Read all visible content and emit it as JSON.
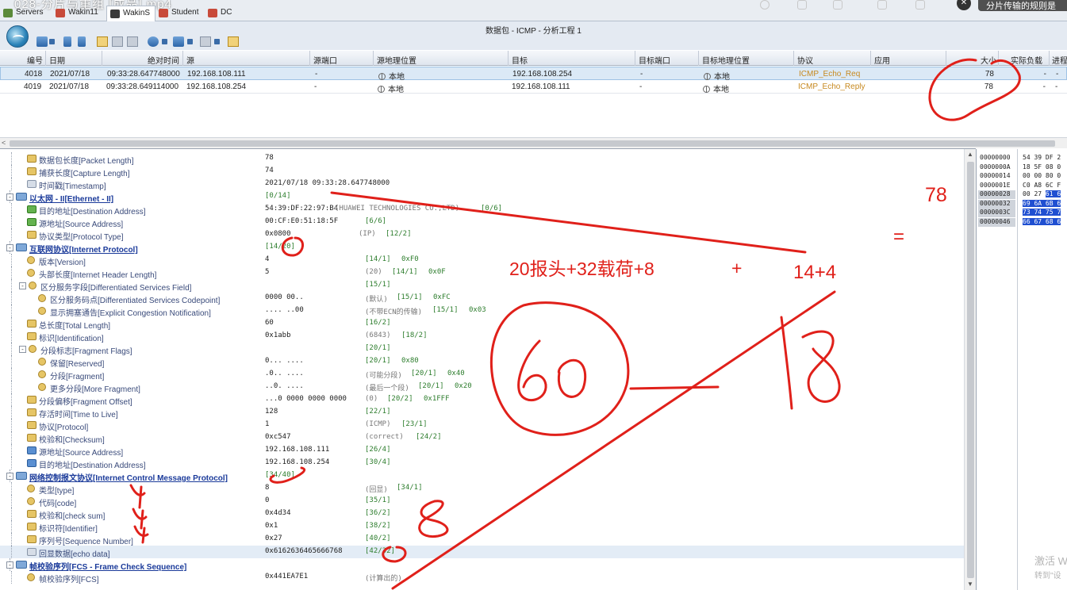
{
  "window": {
    "video_title": "028-分片与重组 [成品].mp4",
    "title": "数据包 - ICMP - 分析工程 1",
    "tooltip": "分片传输的规则是"
  },
  "tabs": [
    {
      "label": "Servers"
    },
    {
      "label": "Wakin11"
    },
    {
      "label": "WakinS"
    },
    {
      "label": "Student"
    },
    {
      "label": "DC"
    }
  ],
  "packet_list": {
    "columns": [
      "编号",
      "日期",
      "绝对时间",
      "源",
      "源端口",
      "源地理位置",
      "目标",
      "目标端口",
      "目标地理位置",
      "协议",
      "应用",
      "大小",
      "实际负载",
      "进程"
    ],
    "rows": [
      {
        "no": "4018",
        "date": "2021/07/18",
        "time": "09:33:28.647748000",
        "src": "192.168.108.111",
        "sport": "-",
        "sgeo": "本地",
        "dst": "192.168.108.254",
        "dport": "-",
        "dgeo": "本地",
        "proto": "ICMP_Echo_Req",
        "app": "",
        "size": "78",
        "payload": "-",
        "proc": "-"
      },
      {
        "no": "4019",
        "date": "2021/07/18",
        "time": "09:33:28.649114000",
        "src": "192.168.108.254",
        "sport": "-",
        "sgeo": "本地",
        "dst": "192.168.108.111",
        "dport": "-",
        "dgeo": "本地",
        "proto": "ICMP_Echo_Reply",
        "app": "",
        "size": "78",
        "payload": "-",
        "proc": "-"
      }
    ]
  },
  "detail_rows": [
    {
      "name": "数据包长度[Packet Length]",
      "value": "78",
      "desc": "",
      "off": "",
      "mask": "",
      "icon": "field",
      "level": 2
    },
    {
      "name": "捕获长度[Capture Length]",
      "value": "74",
      "desc": "",
      "off": "",
      "mask": "",
      "icon": "field",
      "level": 2
    },
    {
      "name": "时间戳[Timestamp]",
      "value": "2021/07/18 09:33:28.647748000",
      "desc": "",
      "off": "",
      "mask": "",
      "icon": "page",
      "level": 2
    },
    {
      "name": "以太网 - II[Ethernet - II]",
      "value": "",
      "desc": "",
      "off": "[0/14]",
      "mask": "",
      "icon": "sec",
      "level": 0,
      "section": true,
      "expander": "-"
    },
    {
      "name": "目的地址[Destination Address]",
      "value": "54:39:DF:22:97:B4",
      "desc": "(HUAWEI TECHNOLOGIES CO.,LTD)",
      "off": "[0/6]",
      "mask": "",
      "icon": "green",
      "level": 2
    },
    {
      "name": "源地址[Source Address]",
      "value": "00:CF:E0:51:18:5F",
      "desc": "",
      "off": "[6/6]",
      "mask": "",
      "icon": "green",
      "level": 2
    },
    {
      "name": "协议类型[Protocol Type]",
      "value": "0x0800",
      "desc": "(IP)",
      "off": "[12/2]",
      "mask": "",
      "icon": "field",
      "level": 2
    },
    {
      "name": "互联网协议[Internet Protocol]",
      "value": "",
      "desc": "",
      "off": "[14/20]",
      "mask": "",
      "icon": "sec",
      "level": 0,
      "section": true,
      "expander": "-"
    },
    {
      "name": "版本[Version]",
      "value": "4",
      "desc": "",
      "off": "[14/1]",
      "mask": "0xF0",
      "icon": "round",
      "level": 2
    },
    {
      "name": "头部长度[Internet Header Length]",
      "value": "5",
      "desc": "(20)",
      "off": "[14/1]",
      "mask": "0x0F",
      "icon": "round",
      "level": 2
    },
    {
      "name": "区分服务字段[Differentiated Services Field]",
      "value": "",
      "desc": "",
      "off": "[15/1]",
      "mask": "",
      "icon": "round",
      "level": 2,
      "expander": "-"
    },
    {
      "name": "区分服务码点[Differentiated Services Codepoint]",
      "value": "0000 00..",
      "desc": "(默认)",
      "off": "[15/1]",
      "mask": "0xFC",
      "icon": "round",
      "level": 3
    },
    {
      "name": "显示拥塞通告[Explicit Congestion Notification]",
      "value": ".... ..00",
      "desc": "(不带ECN的传输)",
      "off": "[15/1]",
      "mask": "0x03",
      "icon": "round",
      "level": 3
    },
    {
      "name": "总长度[Total Length]",
      "value": "60",
      "desc": "",
      "off": "[16/2]",
      "mask": "",
      "icon": "field",
      "level": 2
    },
    {
      "name": "标识[Identification]",
      "value": "0x1abb",
      "desc": "(6843)",
      "off": "[18/2]",
      "mask": "",
      "icon": "field",
      "level": 2
    },
    {
      "name": "分段标志[Fragment Flags]",
      "value": "",
      "desc": "",
      "off": "[20/1]",
      "mask": "",
      "icon": "round",
      "level": 2,
      "expander": "-"
    },
    {
      "name": "保留[Reserved]",
      "value": "0... ....",
      "desc": "",
      "off": "[20/1]",
      "mask": "0x80",
      "icon": "round",
      "level": 3
    },
    {
      "name": "分段[Fragment]",
      "value": ".0.. ....",
      "desc": "(可能分段)",
      "off": "[20/1]",
      "mask": "0x40",
      "icon": "round",
      "level": 3
    },
    {
      "name": "更多分段[More Fragment]",
      "value": "..0. ....",
      "desc": "(最后一个段)",
      "off": "[20/1]",
      "mask": "0x20",
      "icon": "round",
      "level": 3
    },
    {
      "name": "分段偏移[Fragment Offset]",
      "value": "...0 0000 0000 0000",
      "desc": "(0)",
      "off": "[20/2]",
      "mask": "0x1FFF",
      "icon": "field",
      "level": 2
    },
    {
      "name": "存活时间[Time to Live]",
      "value": "128",
      "desc": "",
      "off": "[22/1]",
      "mask": "",
      "icon": "field",
      "level": 2
    },
    {
      "name": "协议[Protocol]",
      "value": "1",
      "desc": "(ICMP)",
      "off": "[23/1]",
      "mask": "",
      "icon": "field",
      "level": 2
    },
    {
      "name": "校验和[Checksum]",
      "value": "0xc547",
      "desc": "(correct)",
      "off": "[24/2]",
      "mask": "",
      "icon": "field",
      "level": 2
    },
    {
      "name": "源地址[Source Address]",
      "value": "192.168.108.111",
      "desc": "",
      "off": "[26/4]",
      "mask": "",
      "icon": "blue",
      "level": 2
    },
    {
      "name": "目的地址[Destination Address]",
      "value": "192.168.108.254",
      "desc": "",
      "off": "[30/4]",
      "mask": "",
      "icon": "blue",
      "level": 2
    },
    {
      "name": "网络控制报文协议[Internet Control Message Protocol]",
      "value": "",
      "desc": "",
      "off": "[34/40]",
      "mask": "",
      "icon": "sec",
      "level": 0,
      "section": true,
      "expander": "-"
    },
    {
      "name": "类型[type]",
      "value": "8",
      "desc": "(回显)",
      "off": "[34/1]",
      "mask": "",
      "icon": "round",
      "level": 2
    },
    {
      "name": "代码[code]",
      "value": "0",
      "desc": "",
      "off": "[35/1]",
      "mask": "",
      "icon": "round",
      "level": 2
    },
    {
      "name": "校验和[check sum]",
      "value": "0x4d34",
      "desc": "",
      "off": "[36/2]",
      "mask": "",
      "icon": "field",
      "level": 2
    },
    {
      "name": "标识符[Identifier]",
      "value": "0x1",
      "desc": "",
      "off": "[38/2]",
      "mask": "",
      "icon": "field",
      "level": 2
    },
    {
      "name": "序列号[Sequence Number]",
      "value": "0x27",
      "desc": "",
      "off": "[40/2]",
      "mask": "",
      "icon": "field",
      "level": 2
    },
    {
      "name": "回显数据[echo data]",
      "value": "0x6162636465666768",
      "desc": "",
      "off": "[42/32]",
      "mask": "",
      "icon": "page",
      "level": 2,
      "highlight": true
    },
    {
      "name": "帧校验序列[FCS - Frame Check Sequence]",
      "value": "",
      "desc": "",
      "off": "",
      "mask": "",
      "icon": "sec",
      "level": 0,
      "section": true,
      "expander": "-"
    },
    {
      "name": "帧校验序列[FCS]",
      "value": "0x441EA7E1",
      "desc": "(计算出的)",
      "off": "",
      "mask": "",
      "icon": "round",
      "level": 2
    }
  ],
  "hex": {
    "offsets": [
      "00000000",
      "0000000A",
      "00000014",
      "0000001E",
      "00000028",
      "00000032",
      "0000003C",
      "00000046"
    ],
    "bytes": [
      "54 39 DF 2",
      "18 5F 08 0",
      "00 00 80 0",
      "C0 A8 6C F",
      "00 27 61 6",
      "69 6A 6B 6",
      "73 74 75 7",
      "66 67 68 6"
    ]
  },
  "watermark": {
    "line1": "激活 W",
    "line2": "转到\"设"
  },
  "annotations": {
    "eq1": "20报头+32载荷+8",
    "plus": "+",
    "eq2": "14+4",
    "total": "78",
    "equals": "=",
    "sixty": "60",
    "eighteen": "18",
    "eight": "8"
  }
}
